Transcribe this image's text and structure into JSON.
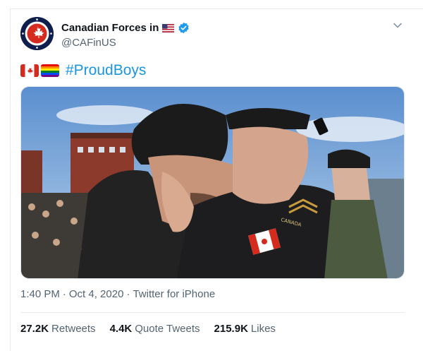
{
  "account": {
    "display_name": "Canadian Forces in",
    "handle": "@CAFinUS",
    "verified": true
  },
  "icons": {
    "avatar": "canadian-forces-roundel-icon",
    "name_flag": "us-flag-icon",
    "verified": "verified-badge-icon",
    "menu": "chevron-down-icon",
    "emoji_1": "canada-flag-icon",
    "emoji_2": "rainbow-flag-icon"
  },
  "tweet": {
    "hashtag": "#ProudBoys",
    "media": {
      "description_visible": false,
      "shoulder_text": "CANADA"
    }
  },
  "meta": {
    "time": "1:40 PM",
    "separator": "·",
    "date": "Oct 4, 2020",
    "source": "Twitter for iPhone"
  },
  "stats": {
    "retweets": {
      "count": "27.2K",
      "label": "Retweets"
    },
    "quotes": {
      "count": "4.4K",
      "label": "Quote Tweets"
    },
    "likes": {
      "count": "215.9K",
      "label": "Likes"
    }
  },
  "colors": {
    "link": "#1b95e0",
    "verified": "#1d9bf0",
    "secondary_text": "#536471",
    "primary_text": "#0f1419",
    "avatar_bg": "#0e1f4d",
    "maple_red": "#d52b1e"
  }
}
